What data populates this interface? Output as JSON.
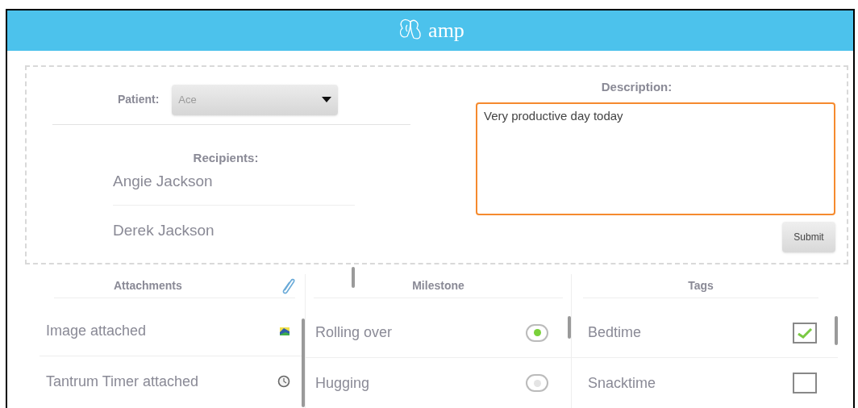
{
  "header": {
    "logo_text": "amp"
  },
  "patient": {
    "label": "Patient:",
    "value": "Ace"
  },
  "recipients": {
    "label": "Recipients:",
    "items": [
      "Angie Jackson",
      "Derek Jackson"
    ]
  },
  "description": {
    "label": "Description:",
    "value": "Very productive day today"
  },
  "submit": "Submit",
  "attachments": {
    "title": "Attachments",
    "items": [
      {
        "label": "Image attached",
        "kind": "image"
      },
      {
        "label": "Tantrum Timer attached",
        "kind": "timer"
      }
    ]
  },
  "milestone": {
    "title": "Milestone",
    "items": [
      {
        "label": "Rolling over",
        "selected": true
      },
      {
        "label": "Hugging",
        "selected": false
      }
    ]
  },
  "tags": {
    "title": "Tags",
    "items": [
      {
        "label": "Bedtime",
        "checked": true
      },
      {
        "label": "Snacktime",
        "checked": false
      }
    ]
  }
}
